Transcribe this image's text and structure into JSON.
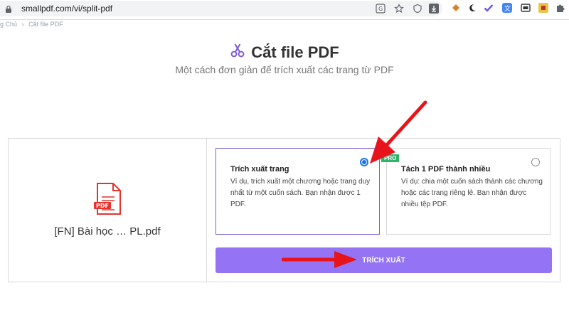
{
  "browser": {
    "url": "smallpdf.com/vi/split-pdf",
    "toolbar_icons": [
      "translate-icon",
      "star-icon",
      "shield-icon",
      "download-icon"
    ],
    "extension_icons": [
      "ext-orange-icon",
      "moon-icon",
      "check-icon",
      "translate-ext-icon",
      "window-icon",
      "pdf-ext-icon",
      "puzzle-icon"
    ]
  },
  "breadcrumb": {
    "home": "g Chủ",
    "separator": "›",
    "current": "Cắt file PDF"
  },
  "header": {
    "title": "Cắt file PDF",
    "subtitle": "Một cách đơn giản để trích xuất các trang từ PDF",
    "icon": "scissors-icon"
  },
  "file": {
    "name": "[FN] Bài học … PL.pdf",
    "icon_label": "PDF"
  },
  "options": [
    {
      "title": "Trích xuất trang",
      "description": "Ví dụ, trích xuất một chương hoặc trang duy nhất từ một cuốn sách. Bạn nhận được 1 PDF.",
      "selected": true
    },
    {
      "title": "Tách 1 PDF thành nhiều",
      "description": "Ví dụ: chia một cuốn sách thành các chương hoặc các trang riêng lẻ. Bạn nhận được nhiều tệp PDF.",
      "selected": false,
      "badge": "PRO"
    }
  ],
  "action": {
    "extract_label": "TRÍCH XUẤT"
  },
  "colors": {
    "accent": "#9474f4",
    "selected_border": "#7b5cd6",
    "radio": "#1a73e8",
    "pro_badge": "#2fb46a",
    "annotation_arrow": "#e8141b",
    "pdf_icon": "#e5322d"
  }
}
